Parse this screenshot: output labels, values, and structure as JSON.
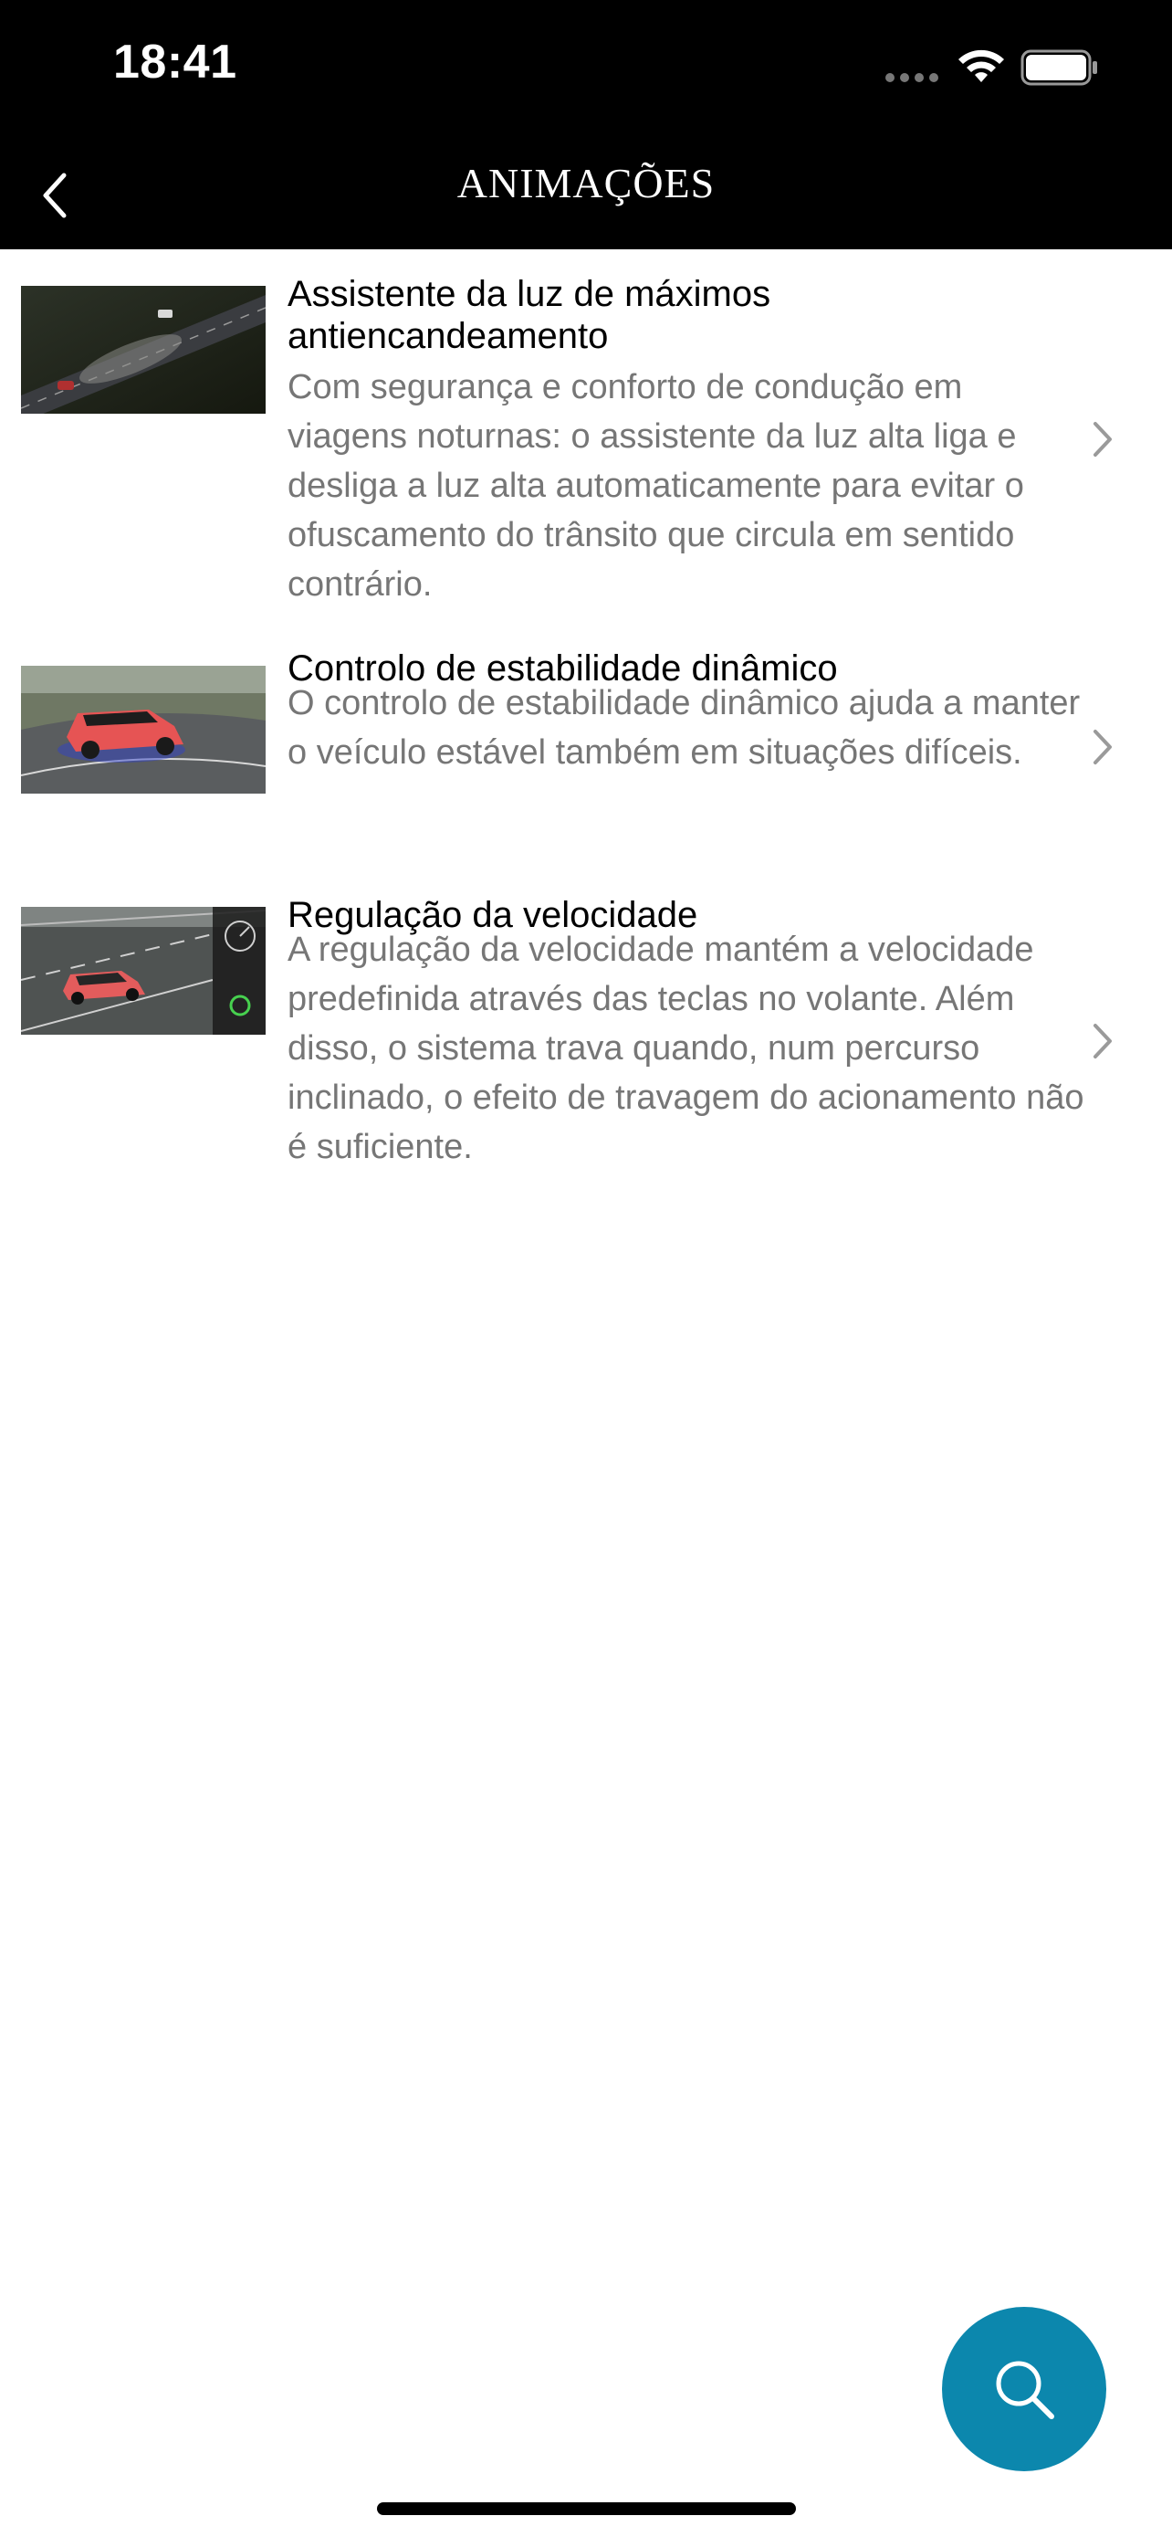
{
  "status_bar": {
    "time": "18:41"
  },
  "nav": {
    "title": "ANIMAÇÕES",
    "back_icon": "chevron-left-icon"
  },
  "items": [
    {
      "title": "Assistente da luz de máximos antiencandeamento",
      "description": "Com segurança e conforto de condução em viagens noturnas: o assistente da luz alta liga e desliga a luz alta automaticamente para evitar o ofuscamento do trânsito que circula em sentido contrário.",
      "icon": "chevron-right-icon"
    },
    {
      "title": "Controlo de estabilidade dinâmico",
      "description": "O controlo de estabilidade dinâmico ajuda a manter o veículo estável também em situações difíceis.",
      "icon": "chevron-right-icon"
    },
    {
      "title": "Regulação da velocidade",
      "description": "A regulação da velocidade mantém a velocidade predefinida através das teclas no volante. Além disso, o sistema trava quando, num percurso inclinado, o efeito de travagem do acionamento não é suficiente.",
      "icon": "chevron-right-icon"
    }
  ],
  "fab": {
    "icon": "search-icon",
    "color": "#0c87ad"
  }
}
